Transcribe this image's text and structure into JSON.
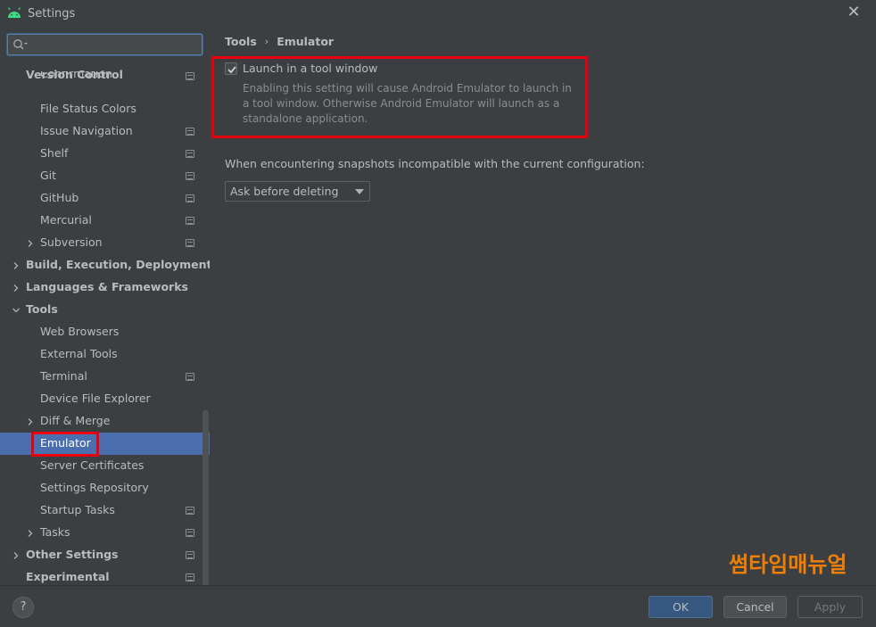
{
  "window": {
    "title": "Settings",
    "close_glyph": "✕"
  },
  "search": {
    "value": "",
    "placeholder": ""
  },
  "tree": {
    "items": [
      {
        "label": "Version Control",
        "level": 0,
        "bold": true,
        "chevron": "none",
        "badge": false,
        "selected": false
      },
      {
        "label": "Confirmation",
        "level": 1,
        "bold": false,
        "chevron": "none",
        "badge": true,
        "selected": false
      },
      {
        "label": "File Status Colors",
        "level": 1,
        "bold": false,
        "chevron": "none",
        "badge": false,
        "selected": false
      },
      {
        "label": "Issue Navigation",
        "level": 1,
        "bold": false,
        "chevron": "none",
        "badge": true,
        "selected": false
      },
      {
        "label": "Shelf",
        "level": 1,
        "bold": false,
        "chevron": "none",
        "badge": true,
        "selected": false
      },
      {
        "label": "Git",
        "level": 1,
        "bold": false,
        "chevron": "none",
        "badge": true,
        "selected": false
      },
      {
        "label": "GitHub",
        "level": 1,
        "bold": false,
        "chevron": "none",
        "badge": true,
        "selected": false
      },
      {
        "label": "Mercurial",
        "level": 1,
        "bold": false,
        "chevron": "none",
        "badge": true,
        "selected": false
      },
      {
        "label": "Subversion",
        "level": 1,
        "bold": false,
        "chevron": "right",
        "badge": true,
        "selected": false
      },
      {
        "label": "Build, Execution, Deployment",
        "level": 0,
        "bold": true,
        "chevron": "right",
        "badge": false,
        "selected": false
      },
      {
        "label": "Languages & Frameworks",
        "level": 0,
        "bold": true,
        "chevron": "right",
        "badge": false,
        "selected": false
      },
      {
        "label": "Tools",
        "level": 0,
        "bold": true,
        "chevron": "down",
        "badge": false,
        "selected": false
      },
      {
        "label": "Web Browsers",
        "level": 1,
        "bold": false,
        "chevron": "none",
        "badge": false,
        "selected": false
      },
      {
        "label": "External Tools",
        "level": 1,
        "bold": false,
        "chevron": "none",
        "badge": false,
        "selected": false
      },
      {
        "label": "Terminal",
        "level": 1,
        "bold": false,
        "chevron": "none",
        "badge": true,
        "selected": false
      },
      {
        "label": "Device File Explorer",
        "level": 1,
        "bold": false,
        "chevron": "none",
        "badge": false,
        "selected": false
      },
      {
        "label": "Diff & Merge",
        "level": 1,
        "bold": false,
        "chevron": "right",
        "badge": false,
        "selected": false
      },
      {
        "label": "Emulator",
        "level": 1,
        "bold": false,
        "chevron": "none",
        "badge": false,
        "selected": true
      },
      {
        "label": "Server Certificates",
        "level": 1,
        "bold": false,
        "chevron": "none",
        "badge": false,
        "selected": false
      },
      {
        "label": "Settings Repository",
        "level": 1,
        "bold": false,
        "chevron": "none",
        "badge": false,
        "selected": false
      },
      {
        "label": "Startup Tasks",
        "level": 1,
        "bold": false,
        "chevron": "none",
        "badge": true,
        "selected": false
      },
      {
        "label": "Tasks",
        "level": 1,
        "bold": false,
        "chevron": "right",
        "badge": true,
        "selected": false
      },
      {
        "label": "Other Settings",
        "level": 0,
        "bold": true,
        "chevron": "right",
        "badge": true,
        "selected": false
      },
      {
        "label": "Experimental",
        "level": 0,
        "bold": true,
        "chevron": "none",
        "badge": true,
        "selected": false
      }
    ]
  },
  "breadcrumb": {
    "parent": "Tools",
    "separator": "›",
    "current": "Emulator"
  },
  "emulator": {
    "launch_in_tool_window": {
      "label": "Launch in a tool window",
      "checked": true,
      "help": "Enabling this setting will cause Android Emulator to launch in a tool window. Otherwise Android Emulator will launch as a standalone application."
    },
    "snapshots": {
      "label": "When encountering snapshots incompatible with the current configuration:",
      "selected": "Ask before deleting"
    }
  },
  "watermark": "썸타임매뉴얼",
  "footer": {
    "help_glyph": "?",
    "ok": "OK",
    "cancel": "Cancel",
    "apply": "Apply"
  },
  "colors": {
    "background": "#3c3f41",
    "selection": "#4b6eaf",
    "annotation_red": "#e8000f",
    "ok_button": "#365880",
    "watermark_orange": "#f07f08",
    "android_green": "#3ddc84"
  }
}
